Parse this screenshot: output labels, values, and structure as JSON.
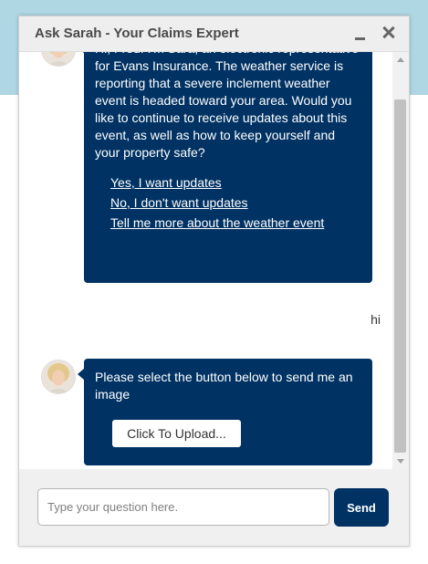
{
  "window": {
    "title": "Ask Sarah - Your Claims Expert"
  },
  "messages": {
    "bot_message_1": {
      "text": "Hi, Fred. I'm Sara, an electronic representative for Evans Insurance. The weather service is reporting that a severe inclement weather event is headed toward your area. Would you like to continue to receive updates about this event, as well as how to keep yourself and your property safe?",
      "links": [
        "Yes, I want updates",
        "No, I don't want updates",
        "Tell me more about the weather event"
      ]
    },
    "user_message_1": {
      "text": "hi"
    },
    "bot_message_2": {
      "text": "Please select the button below to send me an image",
      "button_label": "Click To Upload..."
    }
  },
  "composer": {
    "placeholder": "Type your question here.",
    "value": "",
    "send_label": "Send"
  },
  "colors": {
    "bubble_background": "#003263",
    "header_band": "#aed6e3",
    "send_button": "#003263"
  },
  "icons": {
    "minimize": "minimize-icon",
    "close": "close-icon"
  }
}
